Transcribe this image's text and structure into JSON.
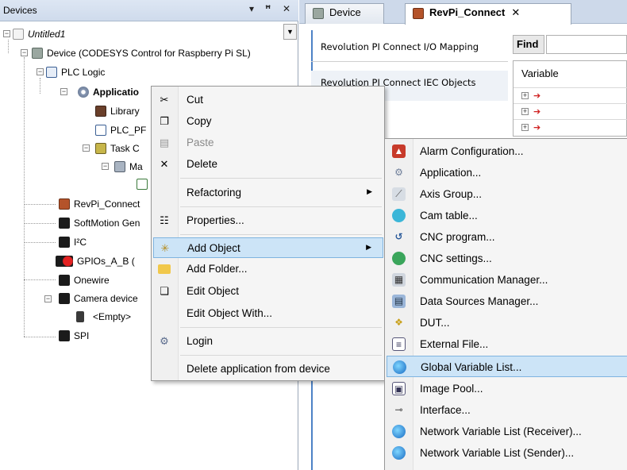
{
  "devices_pane": {
    "title": "Devices",
    "buttons": {
      "dropdown": "▾",
      "pin": "ꟸ",
      "close": "✕"
    }
  },
  "tree": {
    "root": "Untitled1",
    "device": "Device (CODESYS Control for Raspberry Pi SL)",
    "plc_logic": "PLC Logic",
    "application": "Applicatio",
    "library": "Library",
    "plc_prg": "PLC_PF",
    "task_config": "Task C",
    "main_task": "Ma",
    "revpi": "RevPi_Connect",
    "softmotion": "SoftMotion Gen",
    "i2c": "I²C",
    "gpios": "GPIOs_A_B (",
    "onewire": "Onewire",
    "camera": "Camera device",
    "empty": "<Empty>",
    "spi": "SPI"
  },
  "editor": {
    "tabs": [
      {
        "label": "Device"
      },
      {
        "label": "RevPi_Connect",
        "close": "✕"
      }
    ],
    "io_mapping_tab": "Revolution PI Connect I/O Mapping",
    "iec_objects_tab": "Revolution PI Connect IEC Objects",
    "find_label": "Find",
    "variable_header": "Variable"
  },
  "context_menu": {
    "cut": "Cut",
    "copy": "Copy",
    "paste": "Paste",
    "delete": "Delete",
    "refactoring": "Refactoring",
    "properties": "Properties...",
    "add_object": "Add Object",
    "add_folder": "Add Folder...",
    "edit_object": "Edit Object",
    "edit_object_with": "Edit Object With...",
    "login": "Login",
    "delete_app": "Delete application from device"
  },
  "submenu": {
    "items": [
      "Alarm Configuration...",
      "Application...",
      "Axis Group...",
      "Cam table...",
      "CNC program...",
      "CNC settings...",
      "Communication Manager...",
      "Data Sources Manager...",
      "DUT...",
      "External File...",
      "Global Variable List...",
      "Image Pool...",
      "Interface...",
      "Network Variable List (Receiver)...",
      "Network Variable List (Sender)..."
    ],
    "highlighted": "Global Variable List..."
  },
  "colors": {
    "highlight_bg": "#cce4f7",
    "highlight_border": "#7fb4e0",
    "accent_blue": "#4d82c6"
  }
}
